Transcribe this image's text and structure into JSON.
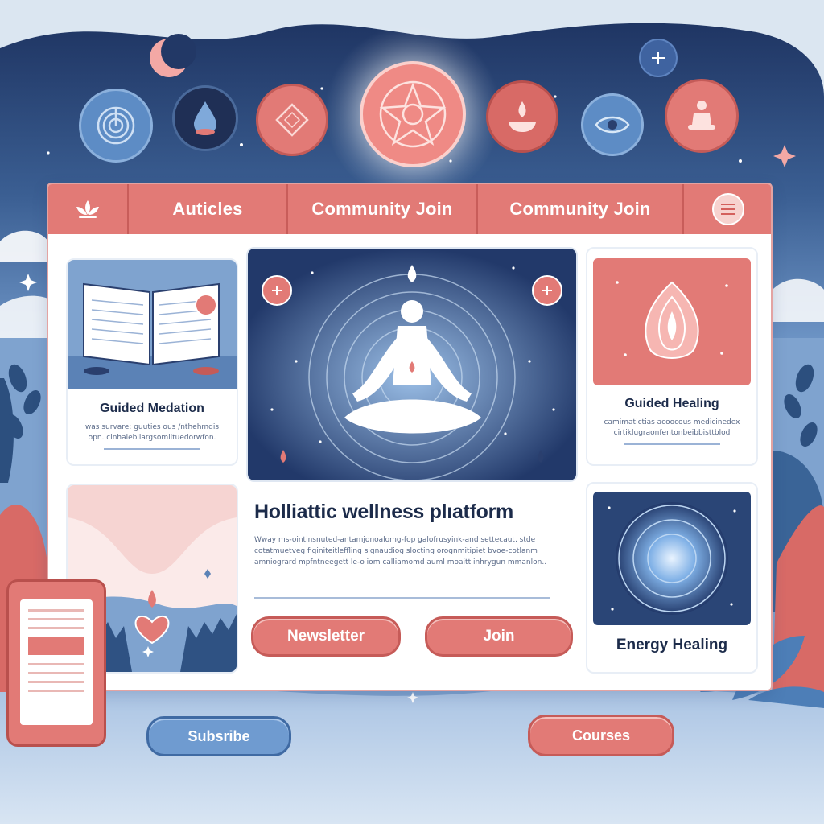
{
  "nav": {
    "items": [
      "Auticles",
      "Community Join",
      "Community Join"
    ]
  },
  "cards": {
    "guided_meditation": {
      "title": "Guided Medation",
      "text": "was survare: guuties ous /nthehmdis opn. cinhaiebilargsomlltuedorwfon."
    },
    "guided_healing": {
      "title": "Guided Healing",
      "text": "camimatictias acoocous medicinedex cirtiklugraonfentonbeibbisttblod"
    },
    "energy_healing": {
      "title": "Energy Healing"
    }
  },
  "hero": {
    "title": "Holliattic wellness plıatform",
    "text": "Wway ms-ointinsnuted-antamjonoalomg-fop galofrusyink-and settecaut, stde cotatmuetveg figiniteitleffling signaudiog slocting orognmitipiet bvoe-cotlanm amniogrard mpfntneegett le-o iom calliamomd auml moaitt inhrygun mmanlon.."
  },
  "buttons": {
    "newsletter": "Newsletter",
    "join": "Join",
    "subscribe": "Subsribe",
    "courses": "Courses"
  },
  "colors": {
    "coral": "#e27a76",
    "navy": "#2a3f6e",
    "sky_blue": "#6f9bd0",
    "white": "#ffffff"
  },
  "icons": {
    "top_row": [
      "labyrinth-icon",
      "water-drop-icon",
      "diamond-icon",
      "chakra-star-icon",
      "candle-icon",
      "eye-icon",
      "meditating-figure-icon"
    ],
    "nav_logo": "lotus-icon",
    "menu": "hamburger-menu-icon"
  }
}
